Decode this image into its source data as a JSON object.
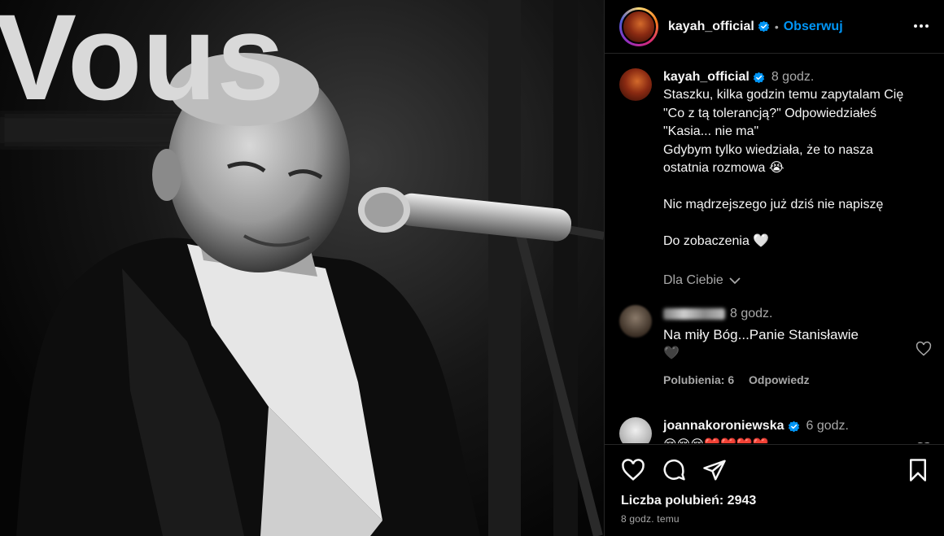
{
  "post": {
    "photo_text": "Vous"
  },
  "header": {
    "username": "kayah_official",
    "dot": "•",
    "follow_label": "Obserwuj"
  },
  "caption": {
    "username": "kayah_official",
    "time": "8 godz.",
    "lines": [
      "Staszku, kilka godzin temu zapytalam Cię",
      "\"Co z tą tolerancją?\" Odpowiedziałeś",
      "\"Kasia... nie ma\"",
      "Gdybym tylko wiedziała, że to nasza",
      "ostatnia rozmowa 😭",
      "",
      "Nic mądrzejszego już dziś nie napiszę",
      "",
      "Do zobaczenia 🤍"
    ],
    "translation_label": "Dla Ciebie"
  },
  "comments": [
    {
      "time": "8 godz.",
      "text": "Na miły Bóg...Panie Stanisławie",
      "emoji": "🖤",
      "likes_label": "Polubienia: 6",
      "reply_label": "Odpowiedz"
    },
    {
      "username": "joannakoroniewska",
      "time": "6 godz.",
      "text": "😢😢😢❤️❤️❤️❤️"
    }
  ],
  "footer": {
    "likes_label": "Liczba polubień: 2943",
    "time_label": "8 godz. temu"
  },
  "colors": {
    "accent": "#0095f6",
    "secondary_text": "#a8a8a8",
    "divider": "#262626"
  },
  "icons": [
    "verified-badge-icon",
    "more-options-icon",
    "heart-icon",
    "comment-icon",
    "share-icon",
    "bookmark-icon",
    "chevron-down-icon"
  ]
}
